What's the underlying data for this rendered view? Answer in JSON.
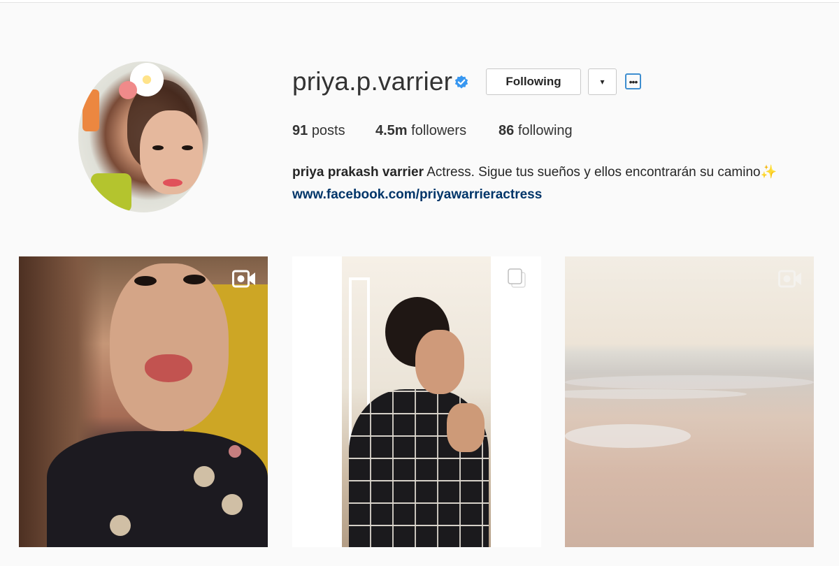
{
  "profile": {
    "username": "priya.p.varrier",
    "verified": true,
    "following_label": "Following",
    "dropdown_symbol": "▾",
    "more_symbol": "•••",
    "stats": {
      "posts_count": "91",
      "posts_label": "posts",
      "followers_count": "4.5m",
      "followers_label": "followers",
      "following_count": "86",
      "following_label": "following"
    },
    "bio": {
      "full_name": "priya prakash varrier",
      "text": "Actress. Sigue tus sueños y ellos encontrarán su camino",
      "emoji": "✨",
      "link": "www.facebook.com/priyawarrieractress"
    }
  },
  "posts": [
    {
      "type": "video",
      "icon": "video-camera-icon"
    },
    {
      "type": "carousel",
      "icon": "multiple-photos-icon"
    },
    {
      "type": "video",
      "icon": "video-camera-icon"
    }
  ],
  "colors": {
    "background": "#fafafa",
    "verified_blue": "#3897f0",
    "link": "#003569",
    "more_border": "#3e8ed0"
  }
}
